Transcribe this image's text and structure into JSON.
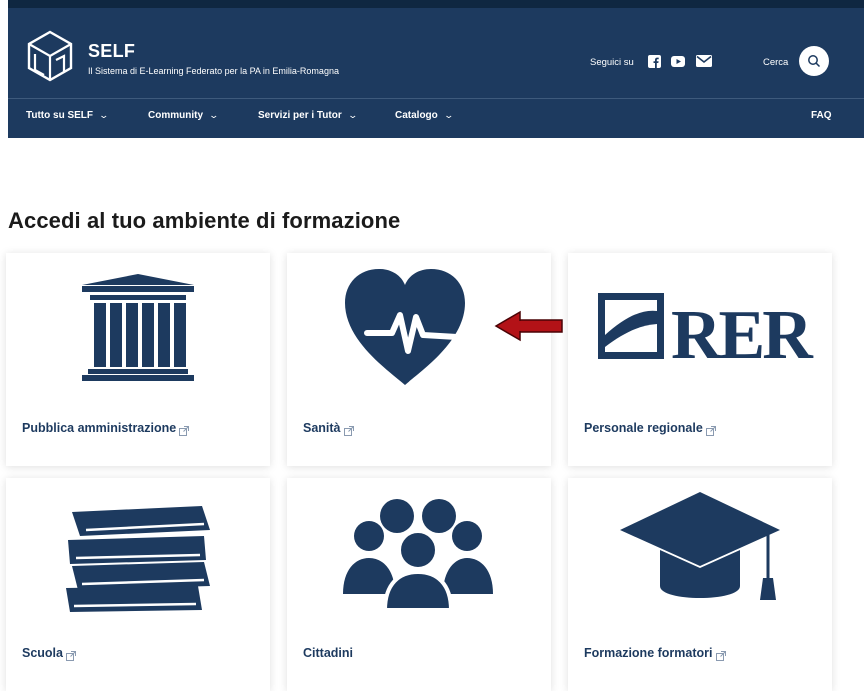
{
  "header": {
    "brand": "SELF",
    "tagline": "Il Sistema di E-Learning Federato per la PA in Emilia-Romagna",
    "follow_label": "Seguici su",
    "social": [
      "facebook-icon",
      "youtube-icon",
      "mail-icon"
    ],
    "search_label": "Cerca",
    "nav": [
      {
        "label": "Tutto su SELF"
      },
      {
        "label": "Community"
      },
      {
        "label": "Servizi per i Tutor"
      },
      {
        "label": "Catalogo"
      }
    ],
    "faq": "FAQ"
  },
  "main": {
    "title": "Accedi al tuo ambiente di formazione",
    "cards": [
      {
        "label": "Pubblica amministrazione",
        "icon": "building-icon",
        "external": true
      },
      {
        "label": "Sanità",
        "icon": "heart-pulse-icon",
        "external": true
      },
      {
        "label": "Personale regionale",
        "icon": "rer-logo",
        "logo_text": "RER",
        "external": true
      },
      {
        "label": "Scuola",
        "icon": "books-icon",
        "external": true
      },
      {
        "label": "Cittadini",
        "icon": "people-icon",
        "external": false
      },
      {
        "label": "Formazione formatori",
        "icon": "graduation-cap-icon",
        "external": true
      }
    ],
    "annotation": {
      "icon": "red-arrow-icon",
      "color": "#b31217"
    }
  },
  "colors": {
    "navy": "#1d3a5f",
    "top_strip": "#0f2741",
    "accent_arrow": "#b31217"
  }
}
